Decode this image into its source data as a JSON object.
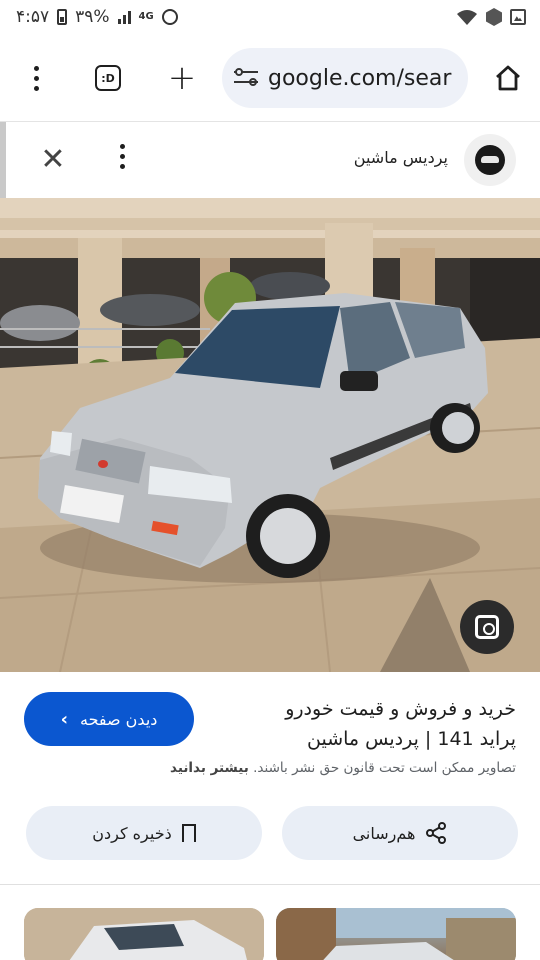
{
  "status_bar": {
    "time": "۴:۵۷",
    "battery": "۳۹%",
    "network": "4G"
  },
  "browser": {
    "url": "google.com/sear",
    "tab_count": ":D"
  },
  "result": {
    "site_name": "پردیس ماشین",
    "title_line1": "خرید و فروش و قیمت خودرو",
    "title_line2": "پراید 141 | پردیس ماشین",
    "copyright_text": "تصاویر ممکن است تحت قانون حق نشر باشند.",
    "learn_more": "بیشتر بدانید",
    "visit_label": "دیدن صفحه",
    "share_label": "هم‌رسانی",
    "save_label": "ذخیره کردن"
  },
  "colors": {
    "primary": "#0b57d0",
    "pill_bg": "#e9eef6",
    "omnibox_bg": "#eef1f8"
  },
  "icons": [
    "battery-icon",
    "signal-icon",
    "alarm-icon",
    "wifi-icon",
    "shield-icon",
    "image-icon",
    "menu-dots-icon",
    "tab-switcher-icon",
    "plus-icon",
    "tune-icon",
    "home-icon",
    "close-icon",
    "site-logo-icon",
    "lens-icon",
    "chevron-left-icon",
    "share-icon",
    "bookmark-icon"
  ]
}
